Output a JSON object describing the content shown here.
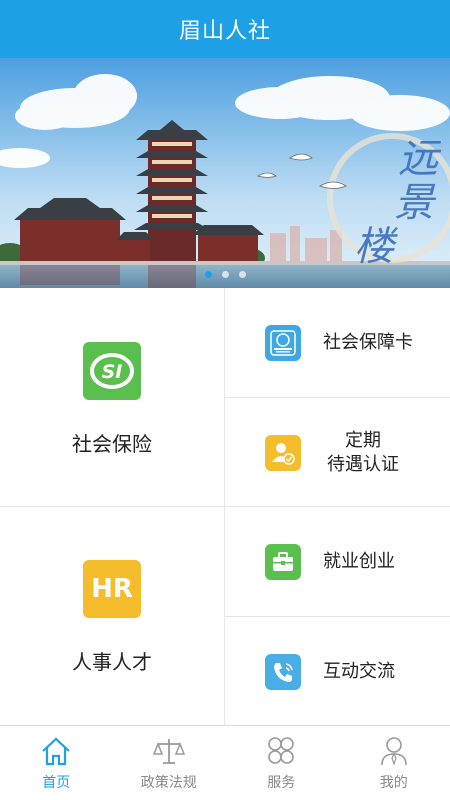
{
  "header": {
    "title": "眉山人社"
  },
  "banner": {
    "caption": [
      "远",
      "景",
      "楼"
    ],
    "dots": [
      true,
      false,
      false
    ]
  },
  "grid": {
    "social_insurance": {
      "label": "社会保险",
      "icon": "si-logo-icon",
      "icon_text": "SI",
      "color": "#5bbf4f"
    },
    "hr_talent": {
      "label": "人事人才",
      "icon": "hr-icon",
      "icon_text": "HR",
      "color": "#f5bc2b"
    },
    "right_items": [
      {
        "label": "社会保障卡",
        "icon": "social-security-card-icon",
        "color": "#3fa8e2"
      },
      {
        "label_line1": "定期",
        "label_line2": "待遇认证",
        "icon": "user-verify-icon",
        "color": "#f5bc2b"
      },
      {
        "label": "就业创业",
        "icon": "briefcase-icon",
        "color": "#5bbf4f"
      },
      {
        "label": "互动交流",
        "icon": "phone-icon",
        "color": "#4aaee6"
      }
    ]
  },
  "tabbar": {
    "tabs": [
      {
        "label": "首页",
        "icon": "home-icon",
        "active": true
      },
      {
        "label": "政策法规",
        "icon": "scales-icon",
        "active": false
      },
      {
        "label": "服务",
        "icon": "grid-icon",
        "active": false
      },
      {
        "label": "我的",
        "icon": "profile-icon",
        "active": false
      }
    ]
  },
  "colors": {
    "primary": "#1ea0e6",
    "text": "#222222",
    "inactive": "#888888"
  }
}
